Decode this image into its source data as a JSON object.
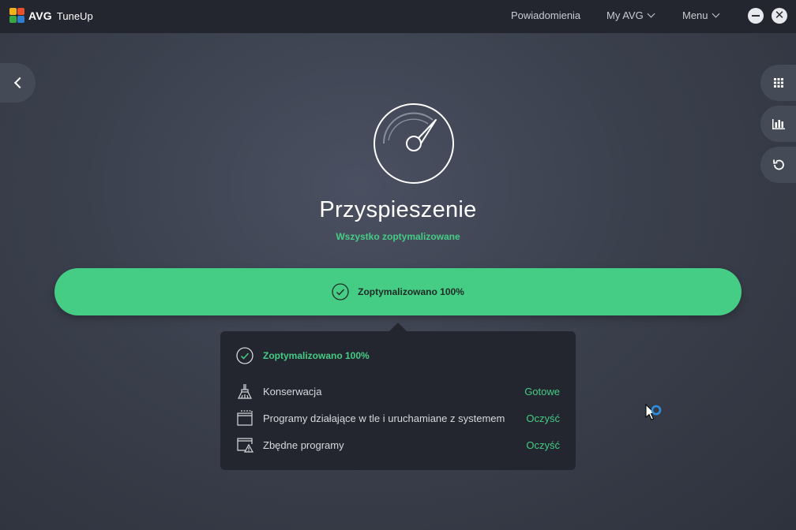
{
  "app": {
    "brand": "AVG",
    "product": "TuneUp"
  },
  "nav": {
    "notifications": "Powiadomienia",
    "my_avg": "My AVG",
    "menu": "Menu"
  },
  "page": {
    "title": "Przyspieszenie",
    "subtitle": "Wszystko zoptymalizowane"
  },
  "progress": {
    "label": "Zoptymalizowano 100%",
    "percent": 100
  },
  "panel": {
    "header": "Zoptymalizowano 100%",
    "items": [
      {
        "label": "Konserwacja",
        "action": "Gotowe",
        "icon": "broom-icon"
      },
      {
        "label": "Programy działające w tle i uruchamiane z systemem",
        "action": "Oczyść",
        "icon": "startup-window-icon"
      },
      {
        "label": "Zbędne programy",
        "action": "Oczyść",
        "icon": "warning-window-icon"
      }
    ]
  },
  "colors": {
    "accent": "#45cc85",
    "titlebar": "#23262e",
    "panel": "#23262e"
  }
}
